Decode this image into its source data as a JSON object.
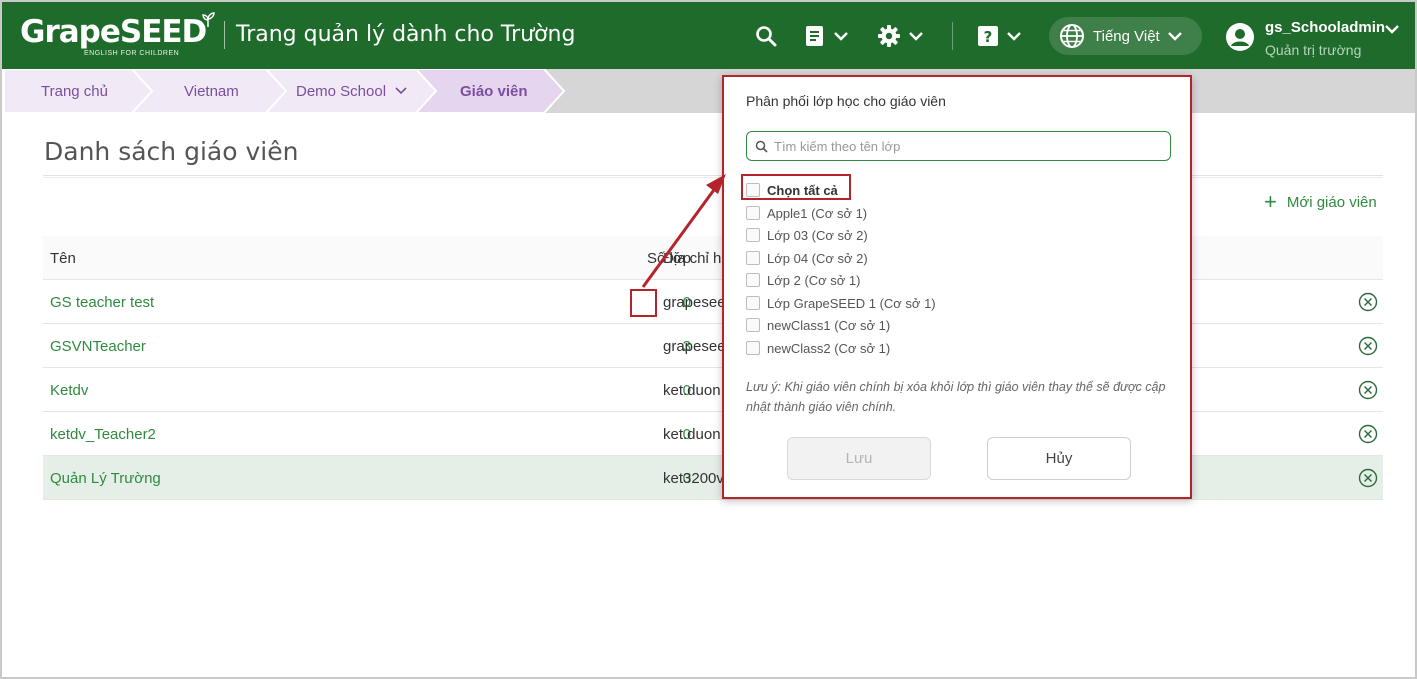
{
  "header": {
    "logo": "GrapeSEED",
    "logo_sub": "ENGLISH FOR CHILDREN",
    "title": "Trang quản lý dành cho Trường",
    "language": "Tiếng Việt",
    "user_name": "gs_Schooladmin",
    "user_role": "Quản trị trường",
    "icons": [
      "search-icon",
      "document-icon",
      "gear-icon",
      "help-icon",
      "globe-icon",
      "user-icon"
    ]
  },
  "breadcrumb": [
    "Trang chủ",
    "Vietnam",
    "Demo School",
    "Giáo viên"
  ],
  "page": {
    "title": "Danh sách giáo viên",
    "new_teacher": "Mới giáo viên"
  },
  "table": {
    "headers": {
      "name": "Tên",
      "count": "Số lớp",
      "email": "Địa chỉ h"
    },
    "rows": [
      {
        "name": "GS teacher test",
        "count": "0",
        "email": "grapesee"
      },
      {
        "name": "GSVNTeacher",
        "count": "3",
        "email": "grapesee"
      },
      {
        "name": "Ketdv",
        "count": "0",
        "email": "ket.duon"
      },
      {
        "name": "ketdv_Teacher2",
        "count": "0",
        "email": "ket.duon"
      },
      {
        "name": "Quản Lý Trường",
        "count": "0",
        "email": "ket3200v"
      }
    ]
  },
  "popover": {
    "title": "Phân phối lớp học cho giáo viên",
    "search_placeholder": "Tìm kiếm theo tên lớp",
    "select_all": "Chọn tất cả",
    "classes": [
      "Apple1 (Cơ sở 1)",
      "Lớp 03 (Cơ sở 2)",
      "Lớp 04 (Cơ sở 2)",
      "Lớp 2 (Cơ sở 1)",
      "Lớp GrapeSEED 1 (Cơ sở 1)",
      "newClass1 (Cơ sở 1)",
      "newClass2 (Cơ sở 1)"
    ],
    "note": "Lưu ý: Khi giáo viên chính bị xóa khỏi lớp thì giáo viên thay thế sẽ được cập nhật thành giáo viên chính.",
    "save": "Lưu",
    "cancel": "Hủy"
  },
  "colors": {
    "header_bg": "#1e6b2b",
    "accent_green": "#2e8b3e",
    "breadcrumb_purple": "#7b4f9e",
    "annotation_red": "#b3252b"
  }
}
